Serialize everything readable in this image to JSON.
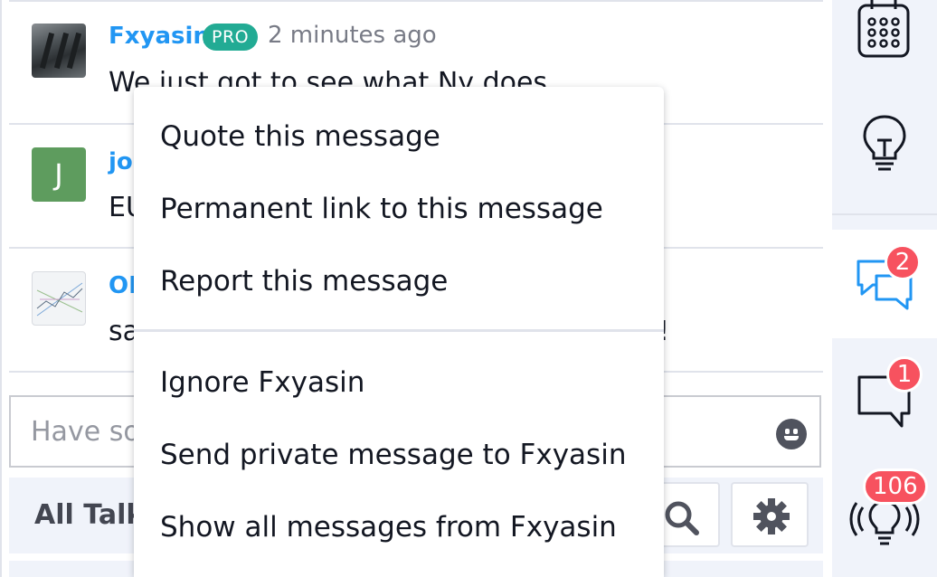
{
  "messages": [
    {
      "username": "Fxyasin",
      "badge": "PRO",
      "time": "2 minutes ago",
      "text": "We just got to see what Ny does"
    },
    {
      "username": "jo",
      "avatar_letter": "J",
      "text": "EU"
    },
    {
      "username": "OE",
      "text": "sa",
      "text_tail": "!"
    }
  ],
  "input": {
    "placeholder": "Have so"
  },
  "toolbar": {
    "label": "All Talk"
  },
  "sidebar": {
    "chat_badge": "2",
    "messages_badge": "1",
    "ideas_badge": "106"
  },
  "context_menu": {
    "items": [
      "Quote this message",
      "Permanent link to this message",
      "Report this message",
      "Ignore Fxyasin",
      "Send private message to Fxyasin",
      "Show all messages from Fxyasin"
    ]
  },
  "colors": {
    "username": "#2196f3",
    "pro_badge": "#22ab94",
    "badge": "#f7525f",
    "active_chat_icon": "#2196f3"
  }
}
